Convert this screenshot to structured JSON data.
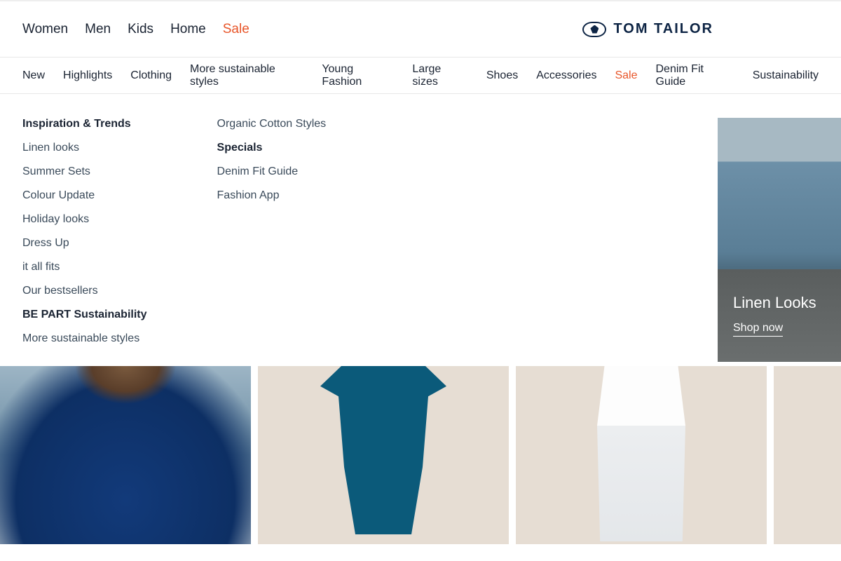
{
  "colors": {
    "accent": "#e8562a",
    "text": "#1a2332",
    "logo": "#0d2444"
  },
  "logo": {
    "text": "TOM TAILOR"
  },
  "primaryNav": {
    "items": [
      {
        "label": "Women",
        "accent": false
      },
      {
        "label": "Men",
        "accent": false
      },
      {
        "label": "Kids",
        "accent": false
      },
      {
        "label": "Home",
        "accent": false
      },
      {
        "label": "Sale",
        "accent": true
      }
    ]
  },
  "secondaryNav": {
    "items": [
      {
        "label": "New",
        "accent": false
      },
      {
        "label": "Highlights",
        "accent": false
      },
      {
        "label": "Clothing",
        "accent": false
      },
      {
        "label": "More sustainable styles",
        "accent": false
      },
      {
        "label": "Young Fashion",
        "accent": false
      },
      {
        "label": "Large sizes",
        "accent": false
      },
      {
        "label": "Shoes",
        "accent": false
      },
      {
        "label": "Accessories",
        "accent": false
      },
      {
        "label": "Sale",
        "accent": true
      },
      {
        "label": "Denim Fit Guide",
        "accent": false
      },
      {
        "label": "Sustainability",
        "accent": false
      }
    ]
  },
  "mega": {
    "col1": {
      "heading": "Inspiration & Trends",
      "items": [
        "Linen looks",
        "Summer Sets",
        "Colour Update",
        "Holiday looks",
        "Dress Up",
        "it all fits",
        "Our bestsellers"
      ],
      "heading2": "BE PART Sustainability",
      "items2": [
        "More sustainable styles"
      ]
    },
    "col2": {
      "preItems": [
        "Organic Cotton Styles"
      ],
      "heading": "Specials",
      "items": [
        "Denim Fit Guide",
        "Fashion App"
      ]
    }
  },
  "hero": {
    "title": "Linen Looks",
    "cta": "Shop now"
  }
}
